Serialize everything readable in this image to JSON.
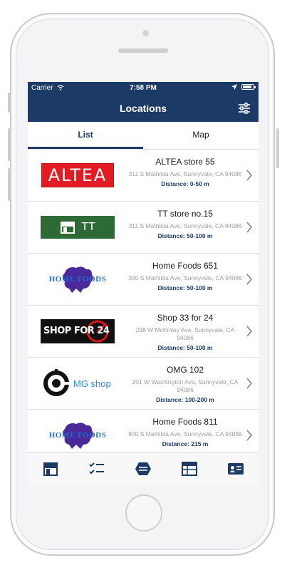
{
  "status_bar": {
    "carrier": "Carrier",
    "time": "7:58 PM",
    "battery_level": 0.85
  },
  "nav": {
    "title": "Locations"
  },
  "tabs": [
    {
      "label": "List",
      "active": true
    },
    {
      "label": "Map",
      "active": false
    }
  ],
  "logos": {
    "altea": "ALTEA",
    "tt": "TT",
    "home_foods": "HOME FOODS",
    "shop": "SHOP FOR 24",
    "mg": "MG shop"
  },
  "stores": [
    {
      "name": "ALTEA store 55",
      "address": "311 S Mathilda Ave, Sunnyvale, CA 94086",
      "distance": "Distance: 0-50 m"
    },
    {
      "name": "TT store no.15",
      "address": "311 S Mathilda Ave, Sunnyvale, CA 94086",
      "distance": "Distance: 50-100 m"
    },
    {
      "name": "Home Foods 651",
      "address": "300 S Mathilda Ave, Sunnyvale, CA 94086",
      "distance": "Distance: 50-100 m"
    },
    {
      "name": "Shop 33 for 24",
      "address": "298 W McKinley Ave, Sunnyvale, CA 94086",
      "distance": "Distance: 50-100 m"
    },
    {
      "name": "OMG 102",
      "address": "201 W Washington Ave, Sunnyvale, CA 94086",
      "distance": "Distance: 100-200 m"
    },
    {
      "name": "Home Foods 811",
      "address": "800 S Mathilda Ave, Sunnyvale, CA 94086",
      "distance": "Distance: 215 m"
    }
  ],
  "icons": [
    "store-icon",
    "checklist-icon",
    "tag-icon",
    "calendar-icon",
    "id-card-icon"
  ],
  "colors": {
    "primary": "#1b3a66",
    "altea": "#e31b23",
    "tt": "#2e6a35",
    "home_foods": "#4a2a9a",
    "shop_red": "#e0121b",
    "mg": "#2d8de0"
  }
}
